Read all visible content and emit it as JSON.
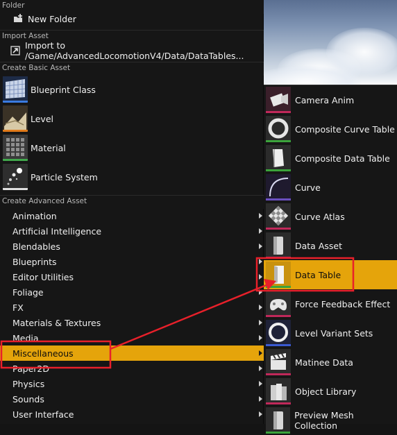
{
  "colors": {
    "highlight": "#e5a40b",
    "annotation": "#e8202a",
    "blueprint_strip": "#3a7be0",
    "level_strip": "#e07a1a",
    "material_strip": "#41a84c",
    "particle_strip": "#e0e0e0",
    "misc_strip": "#3ba33b"
  },
  "sections": {
    "folder": "Folder",
    "import": "Import Asset",
    "basic": "Create Basic Asset",
    "advanced": "Create Advanced Asset"
  },
  "folder_items": {
    "new_folder": "New Folder"
  },
  "import_items": {
    "import_to": "Import to /Game/AdvancedLocomotionV4/Data/DataTables..."
  },
  "basic_assets": [
    {
      "label": "Blueprint Class",
      "icon": "blueprint-icon"
    },
    {
      "label": "Level",
      "icon": "level-icon"
    },
    {
      "label": "Material",
      "icon": "material-icon"
    },
    {
      "label": "Particle System",
      "icon": "particle-icon"
    }
  ],
  "advanced_assets": [
    {
      "label": "Animation"
    },
    {
      "label": "Artificial Intelligence"
    },
    {
      "label": "Blendables"
    },
    {
      "label": "Blueprints"
    },
    {
      "label": "Editor Utilities"
    },
    {
      "label": "Foliage"
    },
    {
      "label": "FX"
    },
    {
      "label": "Materials & Textures"
    },
    {
      "label": "Media"
    },
    {
      "label": "Miscellaneous",
      "selected": true
    },
    {
      "label": "Paper2D"
    },
    {
      "label": "Physics"
    },
    {
      "label": "Sounds"
    },
    {
      "label": "User Interface"
    }
  ],
  "misc_submenu": [
    {
      "label": "Camera Anim",
      "icon": "camera-anim-icon"
    },
    {
      "label": "Composite Curve Table",
      "icon": "composite-curve-table-icon"
    },
    {
      "label": "Composite Data Table",
      "icon": "composite-data-table-icon"
    },
    {
      "label": "Curve",
      "icon": "curve-icon"
    },
    {
      "label": "Curve Atlas",
      "icon": "curve-atlas-icon"
    },
    {
      "label": "Data Asset",
      "icon": "data-asset-icon"
    },
    {
      "label": "Data Table",
      "icon": "data-table-icon",
      "selected": true
    },
    {
      "label": "Force Feedback Effect",
      "icon": "force-feedback-icon"
    },
    {
      "label": "Level Variant Sets",
      "icon": "level-variant-sets-icon"
    },
    {
      "label": "Matinee Data",
      "icon": "matinee-data-icon"
    },
    {
      "label": "Object Library",
      "icon": "object-library-icon"
    },
    {
      "label": "Preview Mesh Collection",
      "icon": "preview-mesh-collection-icon"
    }
  ]
}
